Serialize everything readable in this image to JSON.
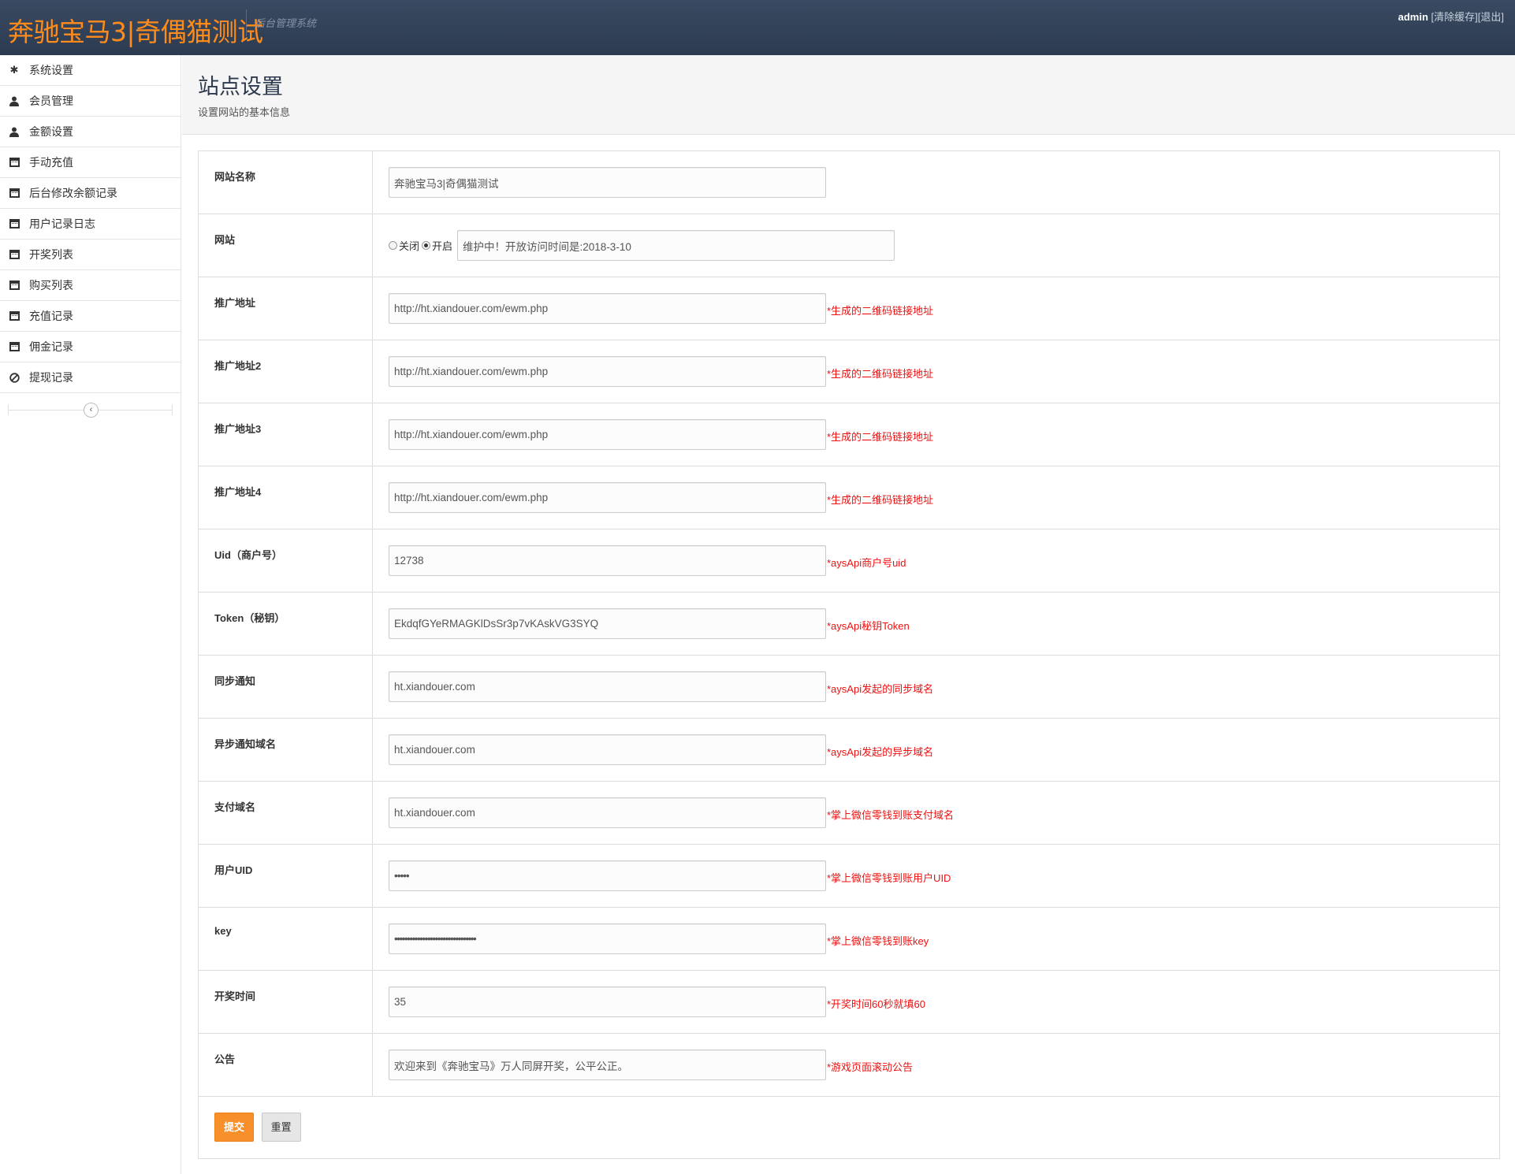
{
  "header": {
    "brand": "奔驰宝马3|奇偶猫测试",
    "subtitle": "后台管理系统",
    "user": "admin",
    "clear_cache": "[清除缓存]",
    "logout": "[退出]"
  },
  "sidebar": {
    "items": [
      {
        "label": "系统设置",
        "icon": "gear-icon"
      },
      {
        "label": "会员管理",
        "icon": "user-icon"
      },
      {
        "label": "金额设置",
        "icon": "user-icon"
      },
      {
        "label": "手动充值",
        "icon": "calendar-icon"
      },
      {
        "label": "后台修改余额记录",
        "icon": "calendar-icon"
      },
      {
        "label": "用户记录日志",
        "icon": "calendar-icon"
      },
      {
        "label": "开奖列表",
        "icon": "calendar-icon"
      },
      {
        "label": "购买列表",
        "icon": "calendar-icon"
      },
      {
        "label": "充值记录",
        "icon": "calendar-icon"
      },
      {
        "label": "佣金记录",
        "icon": "calendar-icon"
      },
      {
        "label": "提现记录",
        "icon": "ban-icon"
      }
    ]
  },
  "page": {
    "title": "站点设置",
    "subtitle": "设置网站的基本信息"
  },
  "form": {
    "site_name": {
      "label": "网站名称",
      "value": "奔驰宝马3|奇偶猫测试"
    },
    "site_status": {
      "label": "网站",
      "off_label": "关闭",
      "on_label": "开启",
      "selected": "开启",
      "value": "维护中！开放访问时间是:2018-3-10"
    },
    "promo1": {
      "label": "推广地址",
      "value": "http://ht.xiandouer.com/ewm.php",
      "hint": "*生成的二维码链接地址"
    },
    "promo2": {
      "label": "推广地址2",
      "value": "http://ht.xiandouer.com/ewm.php",
      "hint": "*生成的二维码链接地址"
    },
    "promo3": {
      "label": "推广地址3",
      "value": "http://ht.xiandouer.com/ewm.php",
      "hint": "*生成的二维码链接地址"
    },
    "promo4": {
      "label": "推广地址4",
      "value": "http://ht.xiandouer.com/ewm.php",
      "hint": "*生成的二维码链接地址"
    },
    "uid": {
      "label": "Uid（商户号）",
      "value": "12738",
      "hint": "*aysApi商户号uid"
    },
    "token": {
      "label": "Token（秘钥）",
      "value": "EkdqfGYeRMAGKlDsSr3p7vKAskVG3SYQ",
      "hint": "*aysApi秘钥Token"
    },
    "sync_notify": {
      "label": "同步通知",
      "value": "ht.xiandouer.com",
      "hint": "*aysApi发起的同步域名"
    },
    "async_notify": {
      "label": "异步通知域名",
      "value": "ht.xiandouer.com",
      "hint": "*aysApi发起的异步域名"
    },
    "pay_domain": {
      "label": "支付域名",
      "value": "ht.xiandouer.com",
      "hint": "*掌上微信零钱到账支付域名"
    },
    "user_uid": {
      "label": "用户UID",
      "value": "•••••",
      "hint": "*掌上微信零钱到账用户UID"
    },
    "key": {
      "label": "key",
      "value": "••••••••••••••••••••••••••••••••",
      "hint": "*掌上微信零钱到账key"
    },
    "draw_time": {
      "label": "开奖时间",
      "value": "35",
      "hint": "*开奖时间60秒就填60"
    },
    "notice": {
      "label": "公告",
      "value": "欢迎来到《奔驰宝马》万人同屏开奖，公平公正。",
      "hint": "*游戏页面滚动公告"
    }
  },
  "actions": {
    "submit": "提交",
    "reset": "重置"
  },
  "colors": {
    "header_bg": "#2f4056",
    "brand": "#ff8c1a",
    "hint": "#f01010",
    "submit_bg": "#f7902a"
  }
}
